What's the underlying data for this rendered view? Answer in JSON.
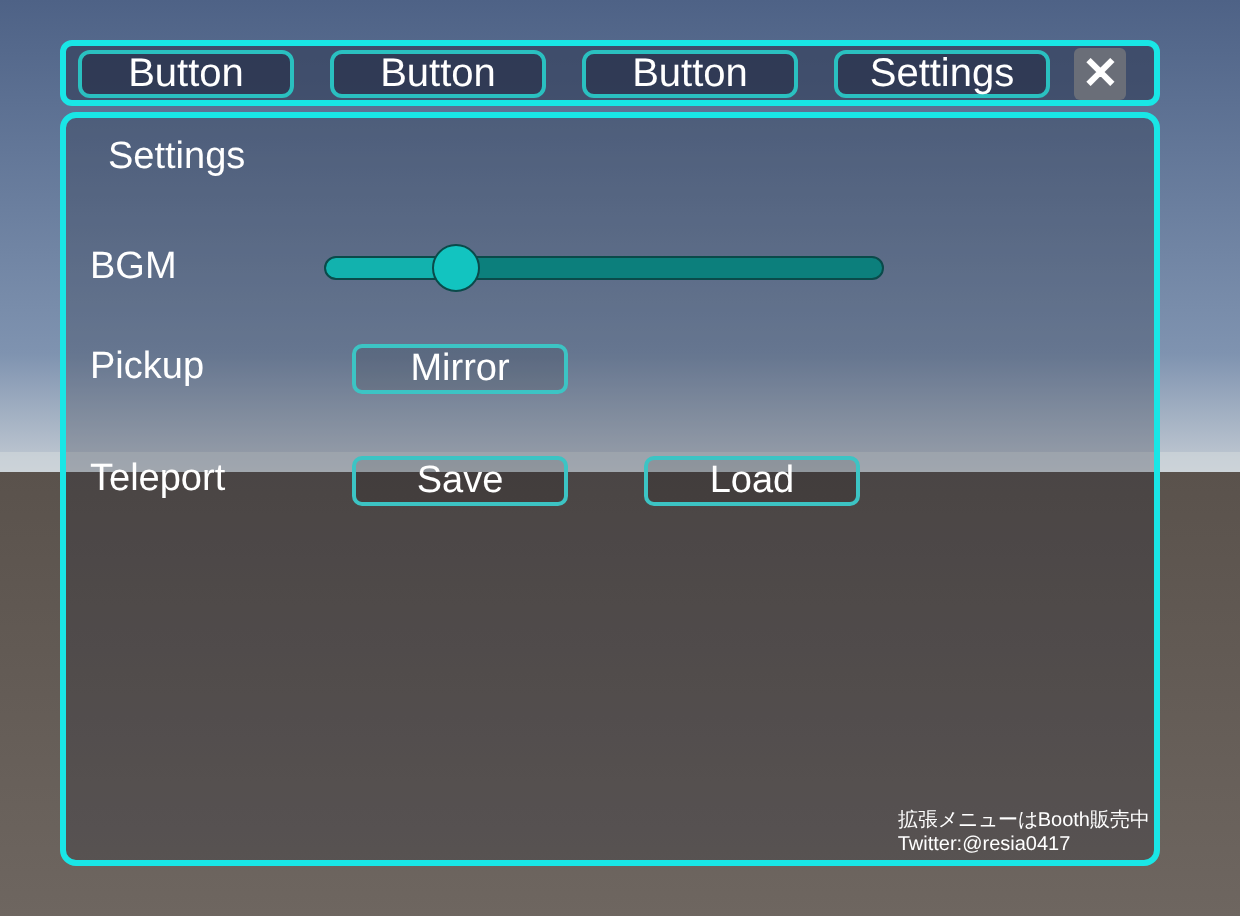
{
  "tab_bar": {
    "buttons": [
      "Button",
      "Button",
      "Button",
      "Settings"
    ],
    "close": "✕"
  },
  "panel": {
    "title": "Settings",
    "rows": [
      {
        "kind": "slider",
        "label": "BGM",
        "level": 0.21
      },
      {
        "kind": "buttons",
        "label": "Pickup",
        "buttons": [
          "Mirror"
        ]
      },
      {
        "kind": "buttons",
        "label": "Teleport",
        "buttons": [
          "Save",
          "Load"
        ]
      }
    ],
    "footer": [
      "拡張メニューはBooth販売中",
      "Twitter:@resia0417"
    ]
  }
}
